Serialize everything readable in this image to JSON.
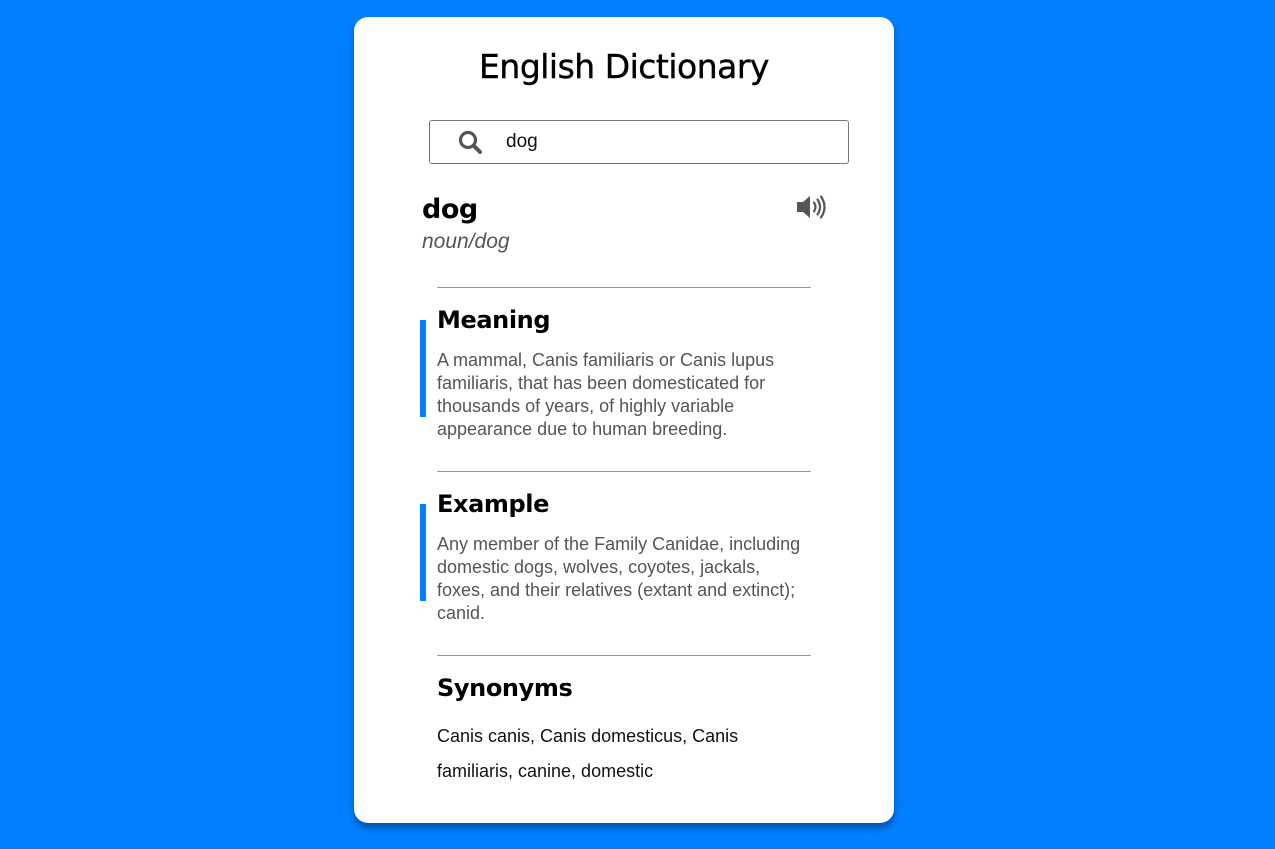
{
  "app": {
    "title": "English Dictionary",
    "accent_color": "#0080ff",
    "background_color": "#0080ff"
  },
  "search": {
    "value": "dog",
    "icon": "search-icon"
  },
  "result": {
    "word": "dog",
    "phonetic": "noun/dog",
    "audio_icon": "speaker-icon"
  },
  "sections": {
    "meaning": {
      "title": "Meaning",
      "text": "A mammal, Canis familiaris or Canis lupus familiaris, that has been domesticated for thousands of years, of highly variable appearance due to human breeding."
    },
    "example": {
      "title": "Example",
      "text": "Any member of the Family Canidae, including domestic dogs, wolves, coyotes, jackals, foxes, and their relatives (extant and extinct); canid."
    },
    "synonyms": {
      "title": "Synonyms",
      "text": " Canis canis, Canis domesticus, Canis familiaris, canine, domestic"
    }
  }
}
